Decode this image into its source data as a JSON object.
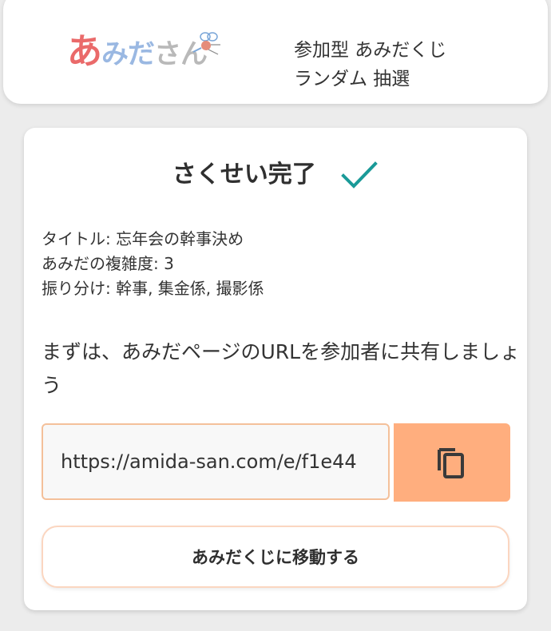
{
  "header": {
    "logo": {
      "part1": "あ",
      "part2": "みだ",
      "part3": "さん"
    },
    "tagline_line1": "参加型 あみだくじ",
    "tagline_line2": "ランダム 抽選"
  },
  "card": {
    "title": "さくせい完了",
    "info": {
      "title_line": "タイトル: 忘年会の幹事決め",
      "complexity_line": "あみだの複雑度: 3",
      "assign_line": "振り分け: 幹事, 集金係, 撮影係"
    },
    "message": "まずは、あみだページのURLを参加者に共有しましょう",
    "url_value": "https://amida-san.com/e/f1e44",
    "move_button_label": "あみだくじに移動する"
  },
  "icons": {
    "check": "check-icon",
    "copy": "copy-icon",
    "bee": "bee-icon"
  },
  "colors": {
    "accent": "#ffae7e",
    "check": "#1a9a98",
    "logo_red": "#ea6a6a",
    "logo_blue": "#9ab8e2",
    "logo_gray": "#b9b9b9"
  }
}
